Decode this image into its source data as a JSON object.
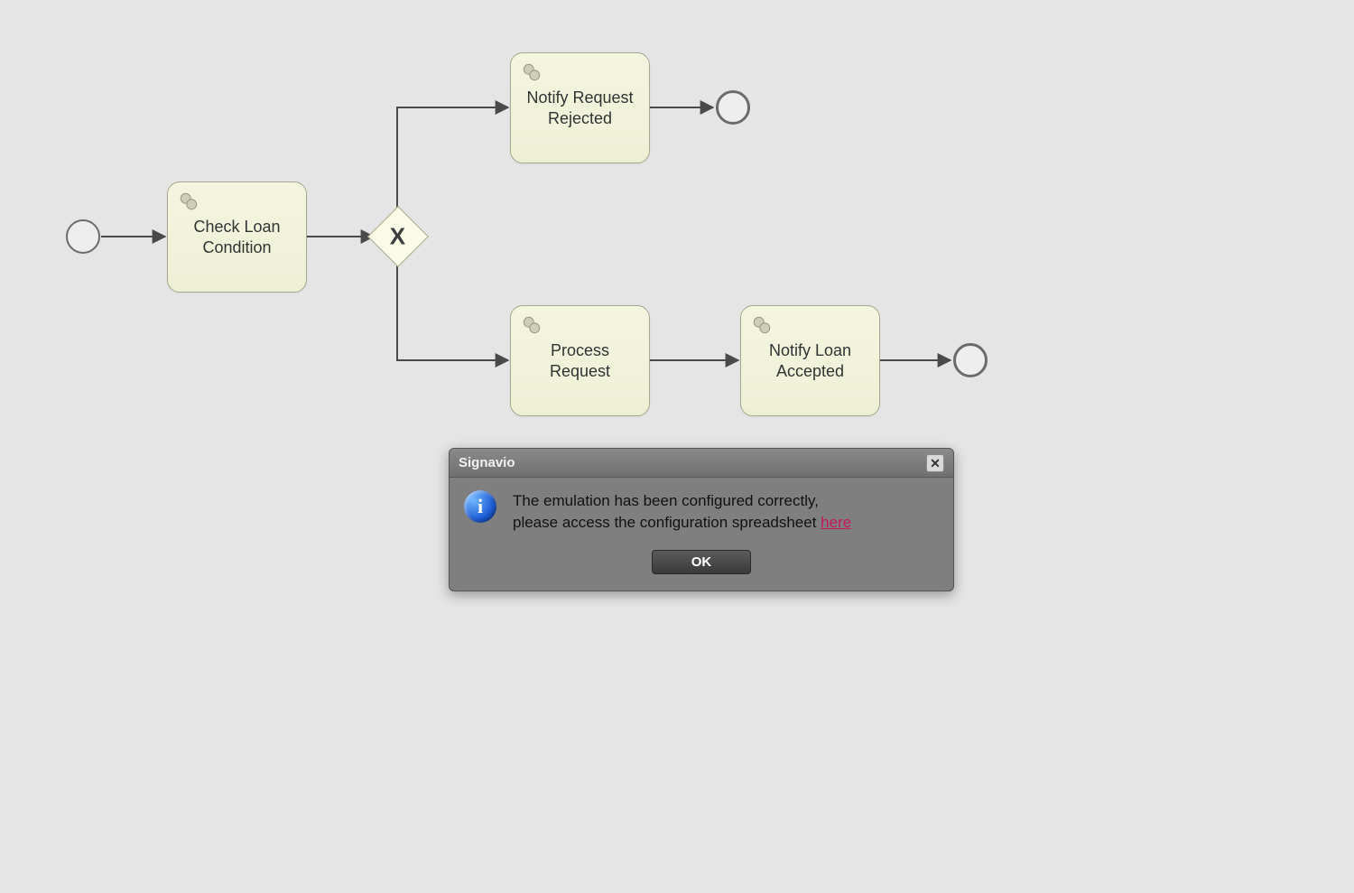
{
  "diagram": {
    "tasks": {
      "check_loan": "Check Loan Condition",
      "notify_rejected": "Notify Request Rejected",
      "process_request": "Process Request",
      "notify_accepted": "Notify Loan Accepted"
    },
    "gateway_marker": "X"
  },
  "dialog": {
    "title": "Signavio",
    "message_line1": "The emulation has been configured correctly,",
    "message_line2": "please access the configuration spreadsheet ",
    "link_text": "here",
    "ok_label": "OK"
  }
}
